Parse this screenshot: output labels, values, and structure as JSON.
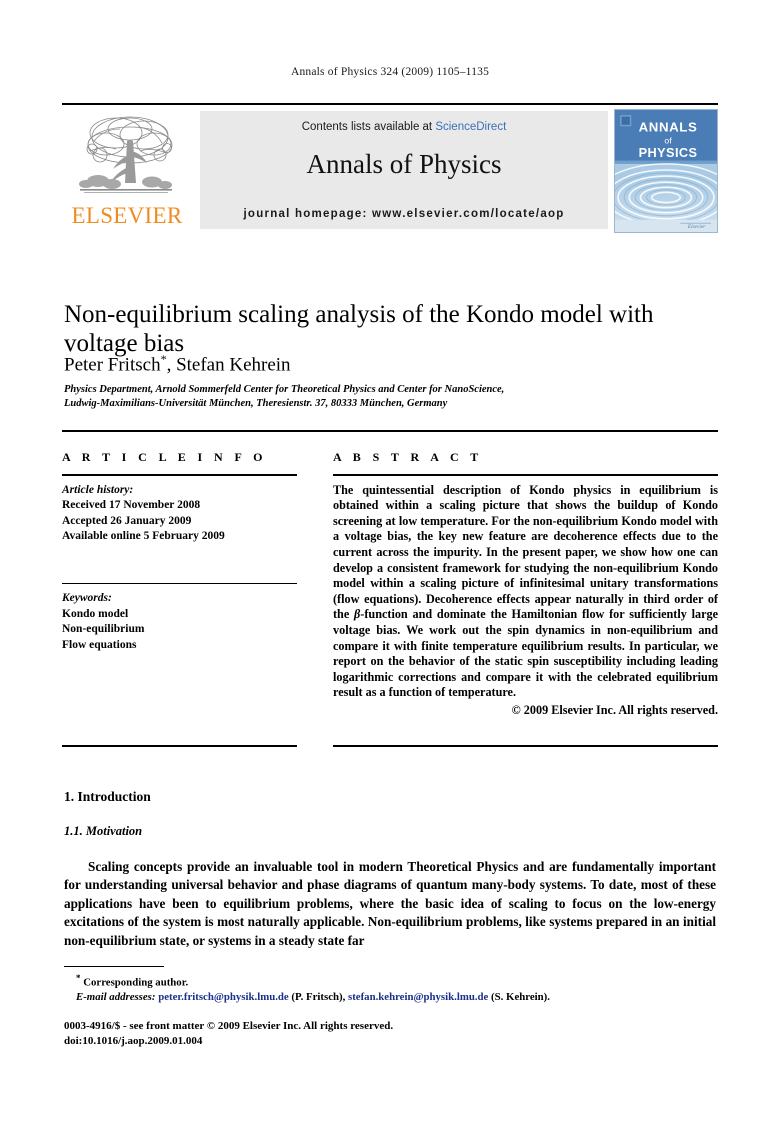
{
  "running_head": "Annals of Physics 324 (2009) 1105–1135",
  "masthead": {
    "publisher_wordmark": "ELSEVIER",
    "contents_prefix": "Contents lists available at ",
    "contents_link": "ScienceDirect",
    "journal_name": "Annals of Physics",
    "homepage": "journal homepage: www.elsevier.com/locate/aop",
    "cover": {
      "line1": "ANNALS",
      "line2": "of",
      "line3": "PHYSICS",
      "footer_mark": "Elsevier"
    },
    "colors": {
      "elsevier_orange": "#F08C1E",
      "sciencedirect_blue": "#3b6fb6",
      "box_gray": "#e9e9e9",
      "cover_blue": "#4a7cb5",
      "cover_light_blue": "#9cc2e0"
    }
  },
  "article": {
    "title": "Non-equilibrium scaling analysis of the Kondo model with voltage bias",
    "authors": "Peter Fritsch",
    "author_marker": "*",
    "authors_rest": ", Stefan Kehrein",
    "affiliation_line1": "Physics Department, Arnold Sommerfeld Center for Theoretical Physics and Center for NanoScience,",
    "affiliation_line2": "Ludwig-Maximilians-Universität München, Theresienstr. 37, 80333 München, Germany"
  },
  "info": {
    "heading": "A R T I C L E   I N F O",
    "history_label": "Article history:",
    "received": "Received 17 November 2008",
    "accepted": "Accepted 26 January 2009",
    "available": "Available online 5 February 2009",
    "keywords_label": "Keywords:",
    "keywords": [
      "Kondo model",
      "Non-equilibrium",
      "Flow equations"
    ]
  },
  "abstract": {
    "heading": "A B S T R A C T",
    "text_part1": "The quintessential description of Kondo physics in equilibrium is obtained within a scaling picture that shows the buildup of Kondo screening at low temperature. For the non-equilibrium Kondo model with a voltage bias, the key new feature are decoherence effects due to the current across the impurity. In the present paper, we show how one can develop a consistent framework for studying the non-equilibrium Kondo model within a scaling picture of infinitesimal unitary transformations (flow equations). Decoherence effects appear naturally in third order of the ",
    "beta_symbol": "β",
    "text_part2": "-function and dominate the Hamiltonian flow for sufficiently large voltage bias. We work out the spin dynamics in non-equilibrium and compare it with finite temperature equilibrium results. In particular, we report on the behavior of the static spin susceptibility including leading logarithmic corrections and compare it with the celebrated equilibrium result as a function of temperature.",
    "copyright": "© 2009 Elsevier Inc. All rights reserved."
  },
  "body": {
    "section_number_title": "1. Introduction",
    "subsection_number_title": "1.1. Motivation",
    "paragraph": "Scaling concepts provide an invaluable tool in modern Theoretical Physics and are fundamentally important for understanding universal behavior and phase diagrams of quantum many-body systems. To date, most of these applications have been to equilibrium problems, where the basic idea of scaling to focus on the low-energy excitations of the system is most naturally applicable. Non-equilibrium problems, like systems prepared in an initial non-equilibrium state, or systems in a steady state far"
  },
  "footnotes": {
    "corresponding": "Corresponding author.",
    "corresponding_marker": "*",
    "email_label": "E-mail addresses:",
    "email1": "peter.fritsch@physik.lmu.de",
    "email1_who": " (P. Fritsch), ",
    "email2": "stefan.kehrein@physik.lmu.de",
    "email2_who": " (S. Kehrein).",
    "issn_line": "0003-4916/$ - see front matter © 2009 Elsevier Inc. All rights reserved.",
    "doi_line": "doi:10.1016/j.aop.2009.01.004"
  }
}
